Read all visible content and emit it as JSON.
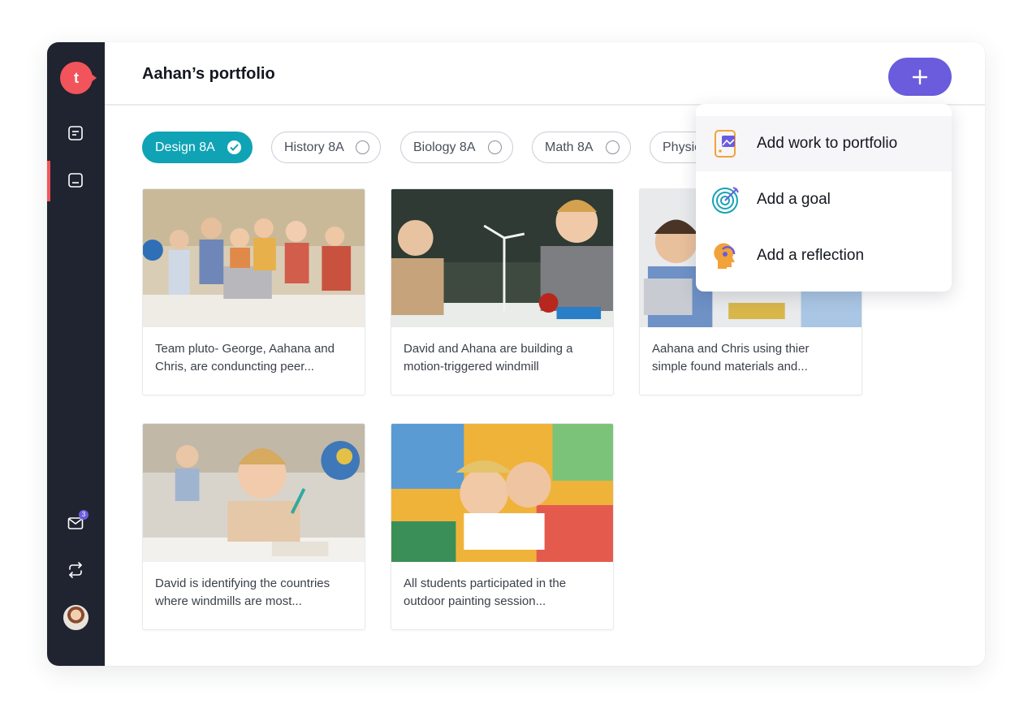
{
  "sidebar": {
    "logo_letter": "t",
    "nav": [
      {
        "icon": "document-icon"
      },
      {
        "icon": "notebook-icon"
      },
      {
        "icon": "mail-icon",
        "badge": "3"
      },
      {
        "icon": "repeat-icon"
      }
    ]
  },
  "header": {
    "title": "Aahan’s portfolio",
    "add_label": "+"
  },
  "filters": [
    {
      "label": "Design 8A",
      "active": true
    },
    {
      "label": "History 8A",
      "active": false
    },
    {
      "label": "Biology 8A",
      "active": false
    },
    {
      "label": "Math 8A",
      "active": false
    },
    {
      "label": "Physic",
      "active": false
    }
  ],
  "cards": [
    {
      "caption_line1": "Team pluto- George, Aahana and",
      "caption_line2": "Chris, are conduncting peer..."
    },
    {
      "caption_line1": "David and Ahana are building a",
      "caption_line2": "motion-triggered windmill"
    },
    {
      "caption_line1": "Aahana and Chris using thier",
      "caption_line2": "simple found materials and..."
    },
    {
      "caption_line1": "David is identifying the countries",
      "caption_line2": "where windmills are most..."
    },
    {
      "caption_line1": "All students participated in the",
      "caption_line2": "outdoor painting session..."
    }
  ],
  "menu": {
    "items": [
      {
        "label": "Add work to portfolio",
        "icon": "image-upload-icon"
      },
      {
        "label": "Add a goal",
        "icon": "target-icon"
      },
      {
        "label": "Add a reflection",
        "icon": "head-reflection-icon"
      }
    ]
  },
  "colors": {
    "sidebar": "#1f2430",
    "brand": "#f2545b",
    "accent": "#6a5cdc",
    "chip_active": "#0fa3b5"
  }
}
